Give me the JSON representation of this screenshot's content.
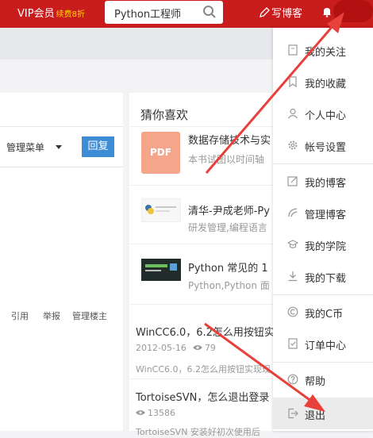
{
  "topbar": {
    "vip_label": "VIP会员",
    "vip_sub": "续费8折",
    "search_text": "Python工程师",
    "write_label": "写博客"
  },
  "left": {
    "manage_label": "管理菜单",
    "reply_label": "回复",
    "actions": [
      "引用",
      "举报",
      "管理楼主"
    ]
  },
  "right": {
    "guess_title": "猜你喜欢",
    "recs": [
      {
        "thumb_text": "PDF",
        "title": "数据存储技术与实",
        "desc": "本书试图以时间轴"
      },
      {
        "title": "清华-尹成老师-Py",
        "desc": "研发管理,编程语言"
      },
      {
        "title": "Python 常见的 1",
        "desc": "Python,Python 面"
      }
    ],
    "blogs": [
      {
        "title": "WinCC6.0，6.2怎么用按钮实",
        "date": "2012-05-16",
        "views": "79",
        "desc": "WinCC6.0，6.2怎么用按钮实现现"
      },
      {
        "title": "TortoiseSVN，怎么退出登录",
        "views": "13586",
        "desc": "TortoiseSVN 安装好初次使用后"
      }
    ]
  },
  "menu": {
    "items": [
      {
        "label": "我的关注",
        "icon": "follow-icon"
      },
      {
        "label": "我的收藏",
        "icon": "bookmark-icon"
      },
      {
        "label": "个人中心",
        "icon": "user-icon"
      },
      {
        "label": "帐号设置",
        "icon": "settings-icon"
      },
      {
        "label": "我的博客",
        "icon": "edit-icon"
      },
      {
        "label": "管理博客",
        "icon": "manage-icon"
      },
      {
        "label": "我的学院",
        "icon": "academy-icon"
      },
      {
        "label": "我的下载",
        "icon": "download-icon"
      },
      {
        "label": "我的C币",
        "icon": "coin-icon"
      },
      {
        "label": "订单中心",
        "icon": "order-icon"
      },
      {
        "label": "帮助",
        "icon": "help-icon"
      },
      {
        "label": "退出",
        "icon": "logout-icon"
      }
    ]
  },
  "colors": {
    "brand_red": "#c91c1c",
    "reply_blue": "#3d8cd6",
    "annotation_arrow": "#e8403b",
    "vip_gold": "#ffd400"
  }
}
